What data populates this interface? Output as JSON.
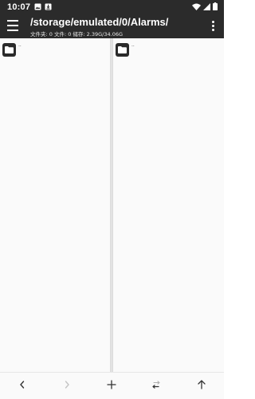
{
  "status_bar": {
    "time": "10:07",
    "notification_icons": [
      "image-icon",
      "download-icon"
    ],
    "system_icons": [
      "wifi-icon",
      "signal-icon",
      "battery-icon"
    ]
  },
  "app_bar": {
    "path": "/storage/emulated/0/Alarms/",
    "subtitle": "文件夹: 0  文件: 0  储存: 2.39G/34.06G",
    "menu_icon": "hamburger-menu-icon",
    "overflow_icon": "more-vert-icon"
  },
  "panes": {
    "left": {
      "items": [
        {
          "name": "..",
          "icon": "folder-icon"
        }
      ]
    },
    "right": {
      "items": [
        {
          "name": "..",
          "icon": "folder-icon"
        }
      ]
    }
  },
  "bottom_nav": {
    "buttons": [
      {
        "name": "back",
        "icon": "chevron-left-icon",
        "enabled": true
      },
      {
        "name": "forward",
        "icon": "chevron-right-icon",
        "enabled": false
      },
      {
        "name": "add",
        "icon": "plus-icon",
        "enabled": true
      },
      {
        "name": "swap",
        "icon": "swap-arrows-icon",
        "enabled": true
      },
      {
        "name": "up",
        "icon": "arrow-up-icon",
        "enabled": true
      }
    ]
  },
  "colors": {
    "bar_dark": "#2b2b2b",
    "pane_bg": "#fafafa",
    "icon_dark": "#333333",
    "icon_disabled": "#c4c4c4"
  }
}
